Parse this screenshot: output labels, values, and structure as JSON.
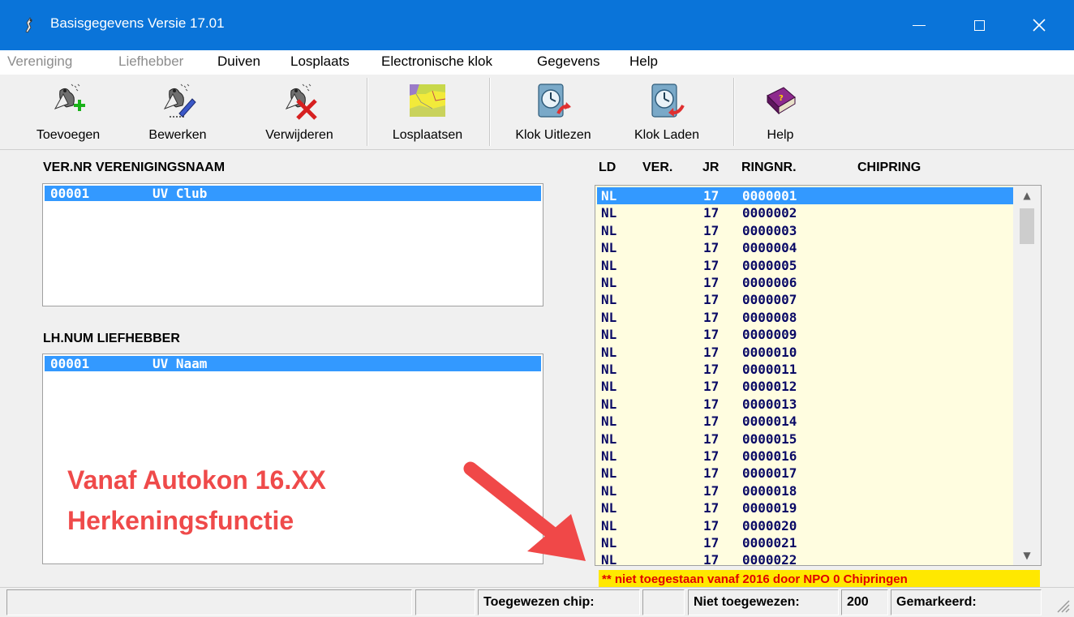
{
  "window": {
    "title": "Basisgegevens Versie 17.01",
    "titlebar_color": "#0a74d9"
  },
  "menu": [
    {
      "label": "Vereniging",
      "disabled": true
    },
    {
      "label": "Liefhebber",
      "disabled": true
    },
    {
      "label": "Duiven",
      "disabled": false
    },
    {
      "label": "Losplaats",
      "disabled": false
    },
    {
      "label": "Electronische klok",
      "disabled": false
    },
    {
      "label": "Gegevens",
      "disabled": false
    },
    {
      "label": "Help",
      "disabled": false
    }
  ],
  "toolbar": {
    "add_label": "Toevoegen",
    "edit_label": "Bewerken",
    "delete_label": "Verwijderen",
    "release_sites_label": "Losplaatsen",
    "clock_read_label": "Klok Uitlezen",
    "clock_load_label": "Klok Laden",
    "help_label": "Help"
  },
  "clubs": {
    "col_nr": "VER.NR",
    "col_name": "VERENIGINGSNAAM",
    "rows": [
      {
        "nr": "00001",
        "name": "UV Club"
      }
    ]
  },
  "fanciers": {
    "col_nr": "LH.NUM",
    "col_name": "LIEFHEBBER",
    "rows": [
      {
        "nr": "00001",
        "name": "UV Naam"
      }
    ]
  },
  "pigeons": {
    "col_country": "LD",
    "col_club": "VER.",
    "col_year": "JR",
    "col_ring": "RINGNR.",
    "col_chip": "CHIPRING",
    "rows": [
      [
        "NL",
        "17",
        "0000001"
      ],
      [
        "NL",
        "17",
        "0000002"
      ],
      [
        "NL",
        "17",
        "0000003"
      ],
      [
        "NL",
        "17",
        "0000004"
      ],
      [
        "NL",
        "17",
        "0000005"
      ],
      [
        "NL",
        "17",
        "0000006"
      ],
      [
        "NL",
        "17",
        "0000007"
      ],
      [
        "NL",
        "17",
        "0000008"
      ],
      [
        "NL",
        "17",
        "0000009"
      ],
      [
        "NL",
        "17",
        "0000010"
      ],
      [
        "NL",
        "17",
        "0000011"
      ],
      [
        "NL",
        "17",
        "0000012"
      ],
      [
        "NL",
        "17",
        "0000013"
      ],
      [
        "NL",
        "17",
        "0000014"
      ],
      [
        "NL",
        "17",
        "0000015"
      ],
      [
        "NL",
        "17",
        "0000016"
      ],
      [
        "NL",
        "17",
        "0000017"
      ],
      [
        "NL",
        "17",
        "0000018"
      ],
      [
        "NL",
        "17",
        "0000019"
      ],
      [
        "NL",
        "17",
        "0000020"
      ],
      [
        "NL",
        "17",
        "0000021"
      ],
      [
        "NL",
        "17",
        "0000022"
      ]
    ],
    "list_bg": "#fffde0",
    "selection_color": "#3399ff"
  },
  "warning": "** niet toegestaan vanaf 2016 door NPO 0 Chipringen",
  "overlay": {
    "line1": "Vanaf Autokon 16.XX",
    "line2": "Herkeningsfunctie",
    "color": "#ef4a4a"
  },
  "status": {
    "assigned_chip_label": "Toegewezen chip:",
    "assigned_chip_value": "",
    "not_assigned_label": "Niet toegewezen:",
    "not_assigned_value": "200",
    "marked_label": "Gemarkeerd:"
  }
}
